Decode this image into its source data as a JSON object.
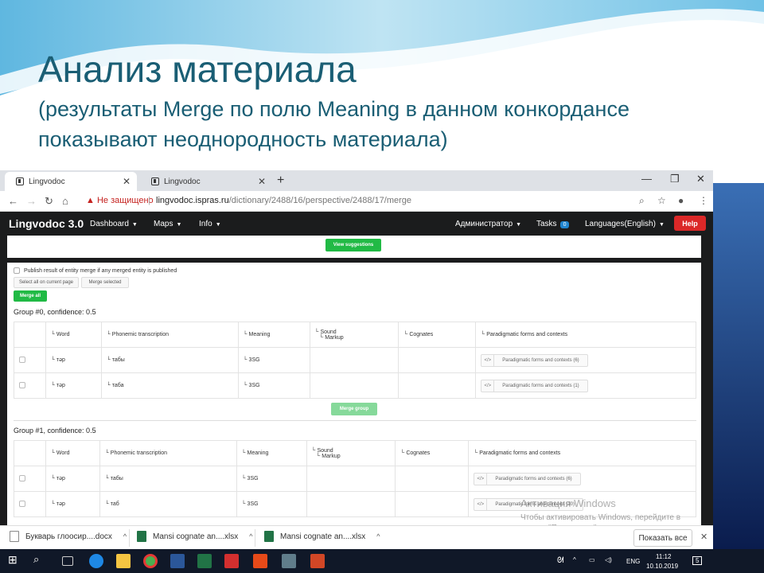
{
  "slide": {
    "title": "Анализ материала",
    "subtitle": "(результаты Merge по полю Meaning в данном конкордансе показывают неоднородность материала)"
  },
  "browser": {
    "tabs": [
      {
        "label": "Lingvodoc"
      },
      {
        "label": "Lingvodoc"
      }
    ],
    "security_label": "Не защищено",
    "url_host": "lingvodoc.ispras.ru",
    "url_path": "/dictionary/2488/16/perspective/2488/17/merge"
  },
  "app": {
    "brand": "Lingvodoc 3.0",
    "menu": [
      {
        "label": "Dashboard"
      },
      {
        "label": "Maps"
      },
      {
        "label": "Info"
      }
    ],
    "user_label": "Администратор",
    "tasks_label": "Tasks",
    "tasks_count": "0",
    "language_label": "Languages(English)",
    "help_label": "Help",
    "view_suggestions_label": "View suggestions",
    "publish_label": "Publish result of entity merge if any merged entity is published",
    "select_all_label": "Select all on current page",
    "merge_selected_label": "Merge selected",
    "merge_all_label": "Merge all",
    "merge_group_label": "Merge group",
    "columns": {
      "word": "Word",
      "phonemic": "Phonemic transcription",
      "meaning": "Meaning",
      "sound": "Sound",
      "markup": "Markup",
      "cognates": "Cognates",
      "paradigmatic": "Paradigmatic forms and contexts"
    },
    "groups": [
      {
        "title": "Group #0, confidence: 0.5",
        "rows": [
          {
            "word": "тəр",
            "phonemic": "табы",
            "meaning": "3SG",
            "para_button": "Paradigmatic forms and contexts (6)"
          },
          {
            "word": "тəр",
            "phonemic": "таба",
            "meaning": "3SG",
            "para_button": "Paradigmatic forms and contexts (1)"
          }
        ]
      },
      {
        "title": "Group #1, confidence: 0.5",
        "rows": [
          {
            "word": "тəр",
            "phonemic": "табы",
            "meaning": "3SG",
            "para_button": "Paradigmatic forms and contexts (6)"
          },
          {
            "word": "тəр",
            "phonemic": "таб",
            "meaning": "3SG",
            "para_button": "Paradigmatic forms and contexts (10)"
          }
        ]
      }
    ]
  },
  "watermark": {
    "line1": "Активация Windows",
    "line2": "Чтобы активировать Windows, перейдите в раздел \"Параметры\"."
  },
  "downloads": {
    "items": [
      {
        "label": "Букварь глоосир....docx",
        "icon": "word-doc-icon",
        "color": "#2b579a"
      },
      {
        "label": "Mansi cognate an....xlsx",
        "icon": "excel-icon",
        "color": "#217346"
      },
      {
        "label": "Mansi cognate an....xlsx",
        "icon": "excel-icon",
        "color": "#217346"
      }
    ],
    "show_all_label": "Показать все"
  },
  "taskbar": {
    "language": "ENG",
    "time": "11:12",
    "date": "10.10.2019",
    "notifications": "5"
  },
  "colors": {
    "slide_text": "#1a5e74",
    "app_nav": "#1b1c1d",
    "green": "#21ba45",
    "help_red": "#db2828",
    "tasks_blue": "#2185d0"
  }
}
